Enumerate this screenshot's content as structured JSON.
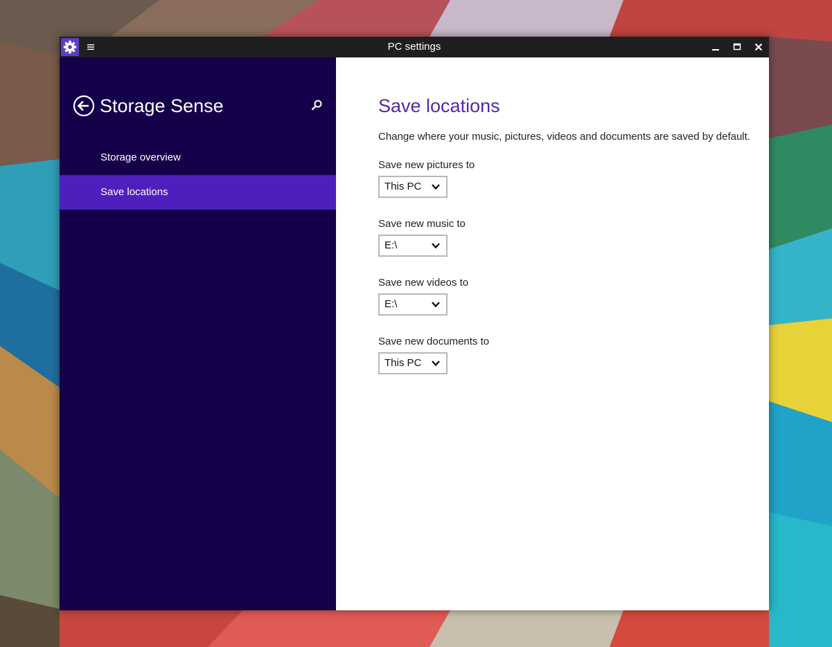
{
  "window": {
    "title": "PC settings"
  },
  "sidebar": {
    "title": "Storage Sense",
    "items": [
      {
        "label": "Storage overview",
        "selected": false
      },
      {
        "label": "Save locations",
        "selected": true
      }
    ]
  },
  "main": {
    "title": "Save locations",
    "description": "Change where your music, pictures, videos and documents are saved by default.",
    "settings": [
      {
        "label": "Save new pictures to",
        "value": "This PC"
      },
      {
        "label": "Save new music to",
        "value": "E:\\"
      },
      {
        "label": "Save new videos to",
        "value": "E:\\"
      },
      {
        "label": "Save new documents to",
        "value": "This PC"
      }
    ]
  },
  "colors": {
    "sidebar_bg": "#15004a",
    "selected_bg": "#4f1fbd",
    "accent_title": "#5428a7",
    "titlebar_bg": "#1f1f1f",
    "app_icon_bg": "#5a3fc0"
  },
  "icons": {
    "app": "gear-icon",
    "menu": "hamburger-menu-icon",
    "back": "back-arrow-icon",
    "search": "search-icon",
    "minimize": "minimize-icon",
    "maximize": "maximize-icon",
    "close": "close-icon",
    "dropdown": "chevron-down-icon"
  }
}
